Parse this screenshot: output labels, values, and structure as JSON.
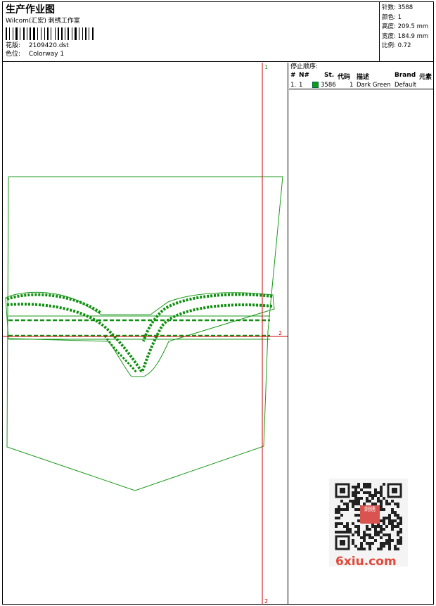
{
  "header": {
    "title": "生产作业图",
    "company": "Wilcom(汇宏) 刺绣工作室",
    "design_label": "花版:",
    "design_value": "2109420.dst",
    "colorway_label": "色位:",
    "colorway_value": "Colorway 1"
  },
  "stats": {
    "stitches": "针数: 3588",
    "colors": "颜色: 1",
    "height": "高度: 209.5 mm",
    "width": "宽度: 184.9 mm",
    "scale": "比例: 0.72"
  },
  "sequence": {
    "title": "停止顺序:",
    "columns": [
      "#",
      "N#",
      "St.",
      "代码",
      "描述",
      "Brand",
      "元素"
    ],
    "rows": [
      {
        "num": "1.",
        "n": "1",
        "stitches": "3586",
        "code": "1",
        "description": "Dark Green",
        "brand": "Default",
        "element": "",
        "color": "#0f9d0f"
      }
    ]
  },
  "canvas": {
    "marker_top": "1",
    "marker_bottom": "2",
    "marker_right": "2",
    "outline_color": "#1a9a1a",
    "stitch_color": "#0f8f0f",
    "guide_color": "#cc0000"
  },
  "watermark": {
    "text": "6xiu.com",
    "seal_text": "刺绣"
  }
}
